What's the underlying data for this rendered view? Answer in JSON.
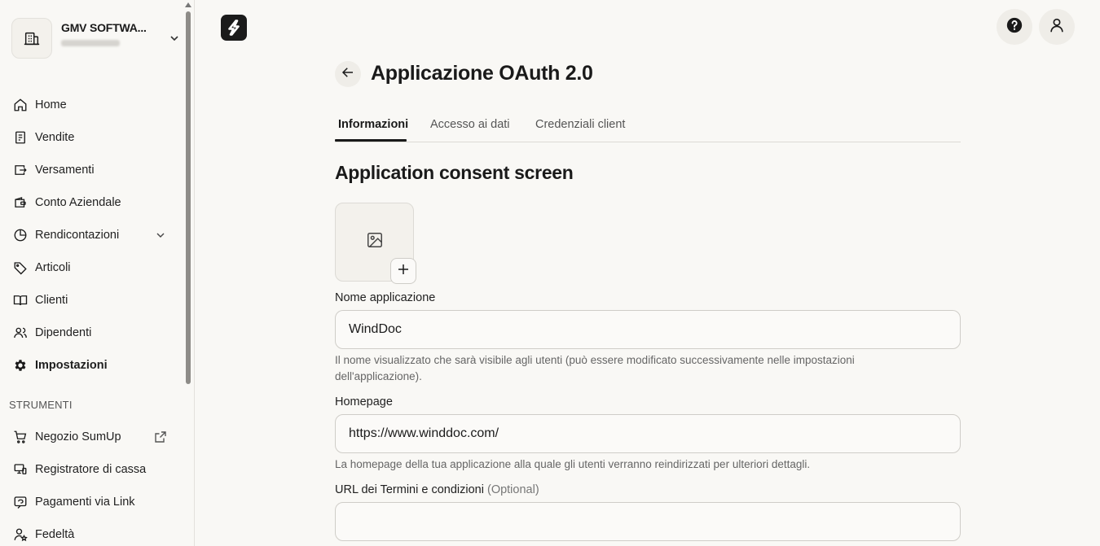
{
  "sidebar": {
    "account": {
      "name": "GMV SOFTWA..."
    },
    "items": [
      {
        "label": "Home",
        "icon": "home-icon"
      },
      {
        "label": "Vendite",
        "icon": "receipt-icon"
      },
      {
        "label": "Versamenti",
        "icon": "payout-icon"
      },
      {
        "label": "Conto Aziendale",
        "icon": "wallet-icon"
      },
      {
        "label": "Rendicontazioni",
        "icon": "pie-chart-icon"
      },
      {
        "label": "Articoli",
        "icon": "tag-icon"
      },
      {
        "label": "Clienti",
        "icon": "book-icon"
      },
      {
        "label": "Dipendenti",
        "icon": "users-icon"
      },
      {
        "label": "Impostazioni",
        "icon": "gear-icon"
      }
    ],
    "tools_label": "STRUMENTI",
    "tools": [
      {
        "label": "Negozio SumUp",
        "icon": "cart-icon"
      },
      {
        "label": "Registratore di cassa",
        "icon": "register-icon"
      },
      {
        "label": "Pagamenti via Link",
        "icon": "link-payment-icon"
      },
      {
        "label": "Fedeltà",
        "icon": "loyalty-icon"
      }
    ]
  },
  "page": {
    "title": "Applicazione OAuth 2.0",
    "tabs": [
      {
        "label": "Informazioni"
      },
      {
        "label": "Accesso ai dati"
      },
      {
        "label": "Credenziali client"
      }
    ],
    "section_title": "Application consent screen",
    "fields": {
      "name": {
        "label": "Nome applicazione",
        "value": "WindDoc",
        "help": "Il nome visualizzato che sarà visibile agli utenti (può essere modificato successivamente nelle impostazioni dell'applicazione)."
      },
      "homepage": {
        "label": "Homepage",
        "value": "https://www.winddoc.com/",
        "help": "La homepage della tua applicazione alla quale gli utenti verranno reindirizzati per ulteriori dettagli."
      },
      "terms": {
        "label": "URL dei Termini e condizioni",
        "optional": "(Optional)",
        "value": ""
      }
    }
  },
  "colors": {
    "background": "#f9f8f5",
    "text": "#1a1a1a",
    "border": "#cfcdc8",
    "logo": "#1b1b1b"
  }
}
